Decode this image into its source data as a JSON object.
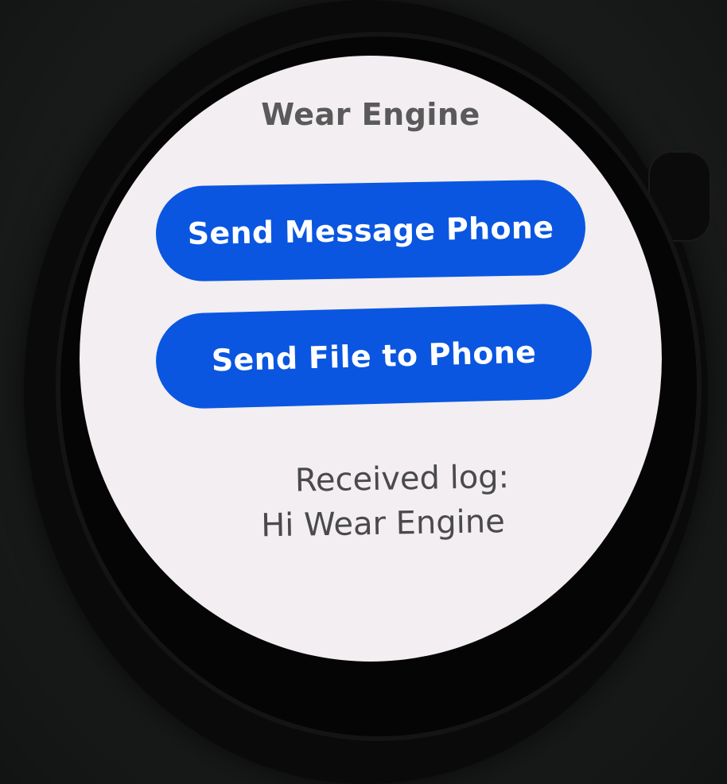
{
  "app": {
    "title": "Wear Engine"
  },
  "buttons": {
    "send_message_label": "Send Message Phone",
    "send_file_label": "Send File to Phone"
  },
  "log": {
    "heading": "Received log:",
    "message": "Hi Wear Engine"
  },
  "colors": {
    "screen_background": "#f2eef1",
    "button_background": "#0a56e0",
    "button_text": "#ffffff",
    "title_text": "#5a5a5a",
    "log_text": "#4a4a4a"
  }
}
